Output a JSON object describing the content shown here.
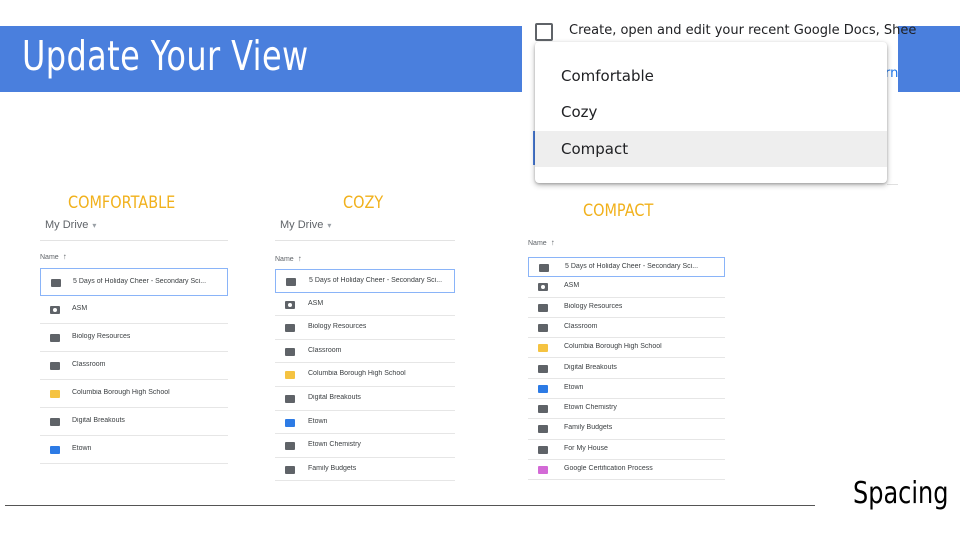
{
  "slide": {
    "title": "Update Your View",
    "footer_label": "Spacing"
  },
  "settings": {
    "checkbox_text": "Create, open and edit your recent Google Docs, Shee",
    "link_fragment": "rn",
    "menu_items": [
      "Comfortable",
      "Cozy",
      "Compact"
    ],
    "selected": "Compact"
  },
  "panels": [
    {
      "label": "COMFORTABLE",
      "drive_title": "My Drive",
      "caret": "▾",
      "name_header": "Name",
      "sort_arrow": "↑",
      "rows": [
        {
          "name": "5 Days of Holiday Cheer - Secondary Sci...",
          "icon": "folder",
          "color": "#5f6368"
        },
        {
          "name": "ASM",
          "icon": "shared-folder",
          "color": "#5f6368"
        },
        {
          "name": "Biology Resources",
          "icon": "folder",
          "color": "#5f6368"
        },
        {
          "name": "Classroom",
          "icon": "folder",
          "color": "#5f6368"
        },
        {
          "name": "Columbia Borough High School",
          "icon": "folder",
          "color": "#f5c341"
        },
        {
          "name": "Digital Breakouts",
          "icon": "folder",
          "color": "#5f6368"
        },
        {
          "name": "Etown",
          "icon": "folder",
          "color": "#2d7be5"
        }
      ]
    },
    {
      "label": "COZY",
      "drive_title": "My Drive",
      "caret": "▾",
      "name_header": "Name",
      "sort_arrow": "↑",
      "rows": [
        {
          "name": "5 Days of Holiday Cheer - Secondary Sci...",
          "icon": "folder",
          "color": "#5f6368"
        },
        {
          "name": "ASM",
          "icon": "shared-folder",
          "color": "#5f6368"
        },
        {
          "name": "Biology Resources",
          "icon": "folder",
          "color": "#5f6368"
        },
        {
          "name": "Classroom",
          "icon": "folder",
          "color": "#5f6368"
        },
        {
          "name": "Columbia Borough High School",
          "icon": "folder",
          "color": "#f5c341"
        },
        {
          "name": "Digital Breakouts",
          "icon": "folder",
          "color": "#5f6368"
        },
        {
          "name": "Etown",
          "icon": "folder",
          "color": "#2d7be5"
        },
        {
          "name": "Etown Chemistry",
          "icon": "folder",
          "color": "#5f6368"
        },
        {
          "name": "Family Budgets",
          "icon": "folder",
          "color": "#5f6368"
        }
      ]
    },
    {
      "label": "COMPACT",
      "drive_title": "",
      "caret": "",
      "name_header": "Name",
      "sort_arrow": "↑",
      "rows": [
        {
          "name": "5 Days of Holiday Cheer - Secondary Sci...",
          "icon": "folder",
          "color": "#5f6368"
        },
        {
          "name": "ASM",
          "icon": "shared-folder",
          "color": "#5f6368"
        },
        {
          "name": "Biology Resources",
          "icon": "folder",
          "color": "#5f6368"
        },
        {
          "name": "Classroom",
          "icon": "folder",
          "color": "#5f6368"
        },
        {
          "name": "Columbia Borough High School",
          "icon": "folder",
          "color": "#f5c341"
        },
        {
          "name": "Digital Breakouts",
          "icon": "folder",
          "color": "#5f6368"
        },
        {
          "name": "Etown",
          "icon": "folder",
          "color": "#2d7be5"
        },
        {
          "name": "Etown Chemistry",
          "icon": "folder",
          "color": "#5f6368"
        },
        {
          "name": "Family Budgets",
          "icon": "folder",
          "color": "#5f6368"
        },
        {
          "name": "For My House",
          "icon": "folder",
          "color": "#5f6368"
        },
        {
          "name": "Google Certification Process",
          "icon": "folder",
          "color": "#d36ad6"
        }
      ]
    }
  ]
}
